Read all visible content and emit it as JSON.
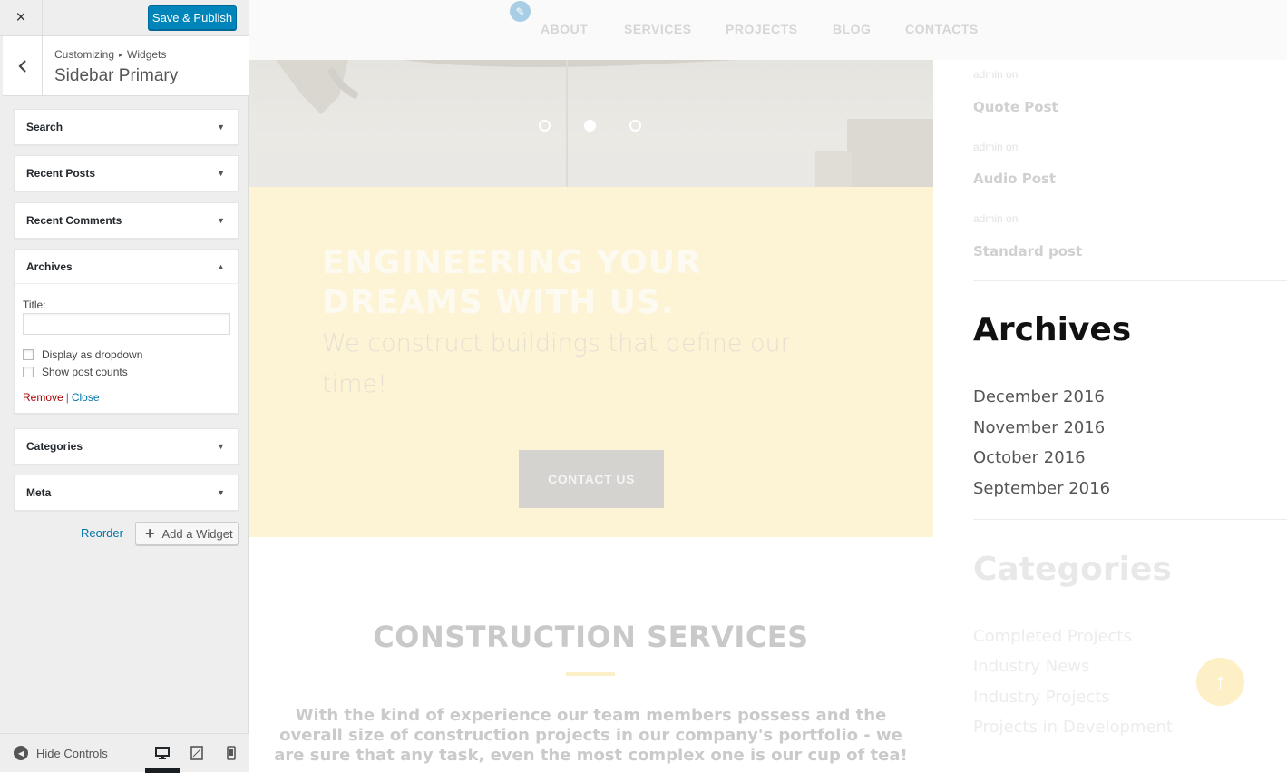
{
  "customizer": {
    "close_label": "×",
    "publish_label": "Save & Publish",
    "back_label": "‹",
    "breadcrumb": [
      "Customizing",
      "Widgets"
    ],
    "breadcrumb_sep": "▸",
    "section_title": "Sidebar Primary",
    "widgets": [
      {
        "title": "Search",
        "open": false
      },
      {
        "title": "Recent Posts",
        "open": false
      },
      {
        "title": "Recent Comments",
        "open": false
      },
      {
        "title": "Archives",
        "open": true
      },
      {
        "title": "Categories",
        "open": false
      },
      {
        "title": "Meta",
        "open": false
      }
    ],
    "archives_form": {
      "title_label": "Title:",
      "title_value": "",
      "dropdown_label": "Display as dropdown",
      "counts_label": "Show post counts",
      "remove_label": "Remove",
      "separator": "|",
      "close_label": "Close"
    },
    "reorder_label": "Reorder",
    "add_widget_label": "Add a Widget",
    "add_widget_icon": "+",
    "hide_controls_label": "Hide Controls",
    "devices": [
      "desktop-icon",
      "tablet-icon",
      "mobile-icon"
    ],
    "active_device": "desktop"
  },
  "preview": {
    "nav": [
      "ABOUT",
      "SERVICES",
      "PROJECTS",
      "BLOG",
      "CONTACTS"
    ],
    "slider_dots": 3,
    "slider_active": 1,
    "hero_title": "ENGINEERING YOUR DREAMS WITH US.",
    "hero_sub": "We construct buildings that define our time!",
    "cta_label": "CONTACT US",
    "services_title": "CONSTRUCTION SERVICES",
    "services_text": "With the kind of experience our team members possess and the overall size of construction projects in our company's portfolio - we are sure that any task, even the most complex one is our cup of tea!",
    "recent_posts": [
      {
        "meta": "admin on",
        "title": "Quote Post"
      },
      {
        "meta": "admin on",
        "title": "Audio Post"
      },
      {
        "meta": "admin on",
        "title": "Standard post"
      }
    ],
    "archives_heading": "Archives",
    "archives": [
      "December 2016",
      "November 2016",
      "October 2016",
      "September 2016"
    ],
    "categories_heading": "Categories",
    "categories": [
      "Completed Projects",
      "Industry News",
      "Industry Projects",
      "Projects in Development"
    ],
    "to_top_icon": "↑"
  },
  "colors": {
    "publish": "#0085ba",
    "link": "#0073aa",
    "remove": "#aa0000",
    "hero_bg": "#fdf3d5"
  }
}
